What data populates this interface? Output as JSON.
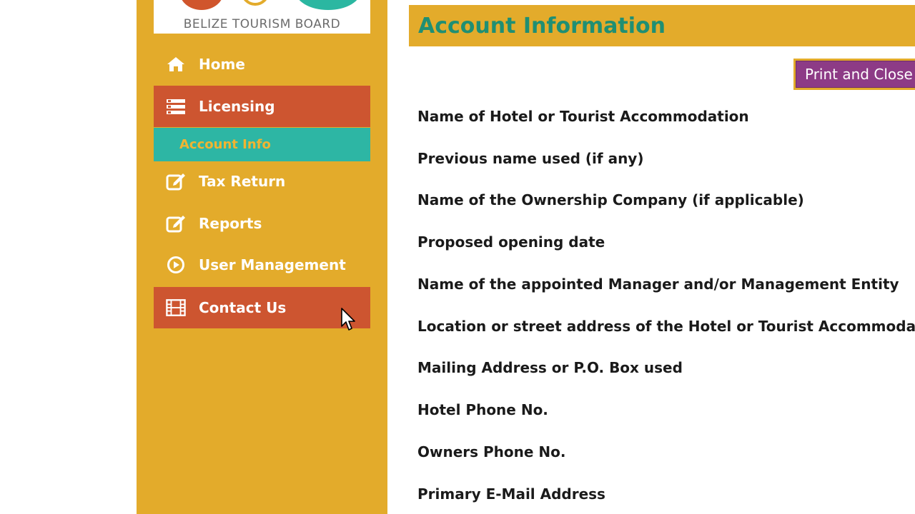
{
  "sidebar": {
    "logo_text": "BELIZE TOURISM BOARD",
    "items": [
      {
        "label": "Home",
        "icon": "home-icon"
      },
      {
        "label": "Licensing",
        "icon": "list-icon"
      },
      {
        "label": "Account Info"
      },
      {
        "label": "Tax Return",
        "icon": "edit-icon"
      },
      {
        "label": "Reports",
        "icon": "edit-icon"
      },
      {
        "label": "User Management",
        "icon": "play-circle-icon"
      },
      {
        "label": "Contact Us",
        "icon": "film-icon"
      }
    ]
  },
  "main": {
    "title": "Account Information",
    "print_button_label": "Print and Close",
    "fields": [
      "Name of Hotel or Tourist Accommodation",
      "Previous name used (if any)",
      "Name of the Ownership Company (if applicable)",
      "Proposed opening date",
      "Name of the appointed Manager and/or Management Entity",
      "Location or street address of the Hotel or Tourist Accommodation",
      "Mailing Address or P.O. Box used",
      "Hotel Phone No.",
      "Owners Phone No.",
      "Primary E-Mail Address"
    ]
  },
  "colors": {
    "sidebar_bg": "#e3ab2b",
    "active_item": "#cd5530",
    "sub_item": "#2db6a4",
    "title": "#1f8f73",
    "print_button": "#8d3b86"
  }
}
